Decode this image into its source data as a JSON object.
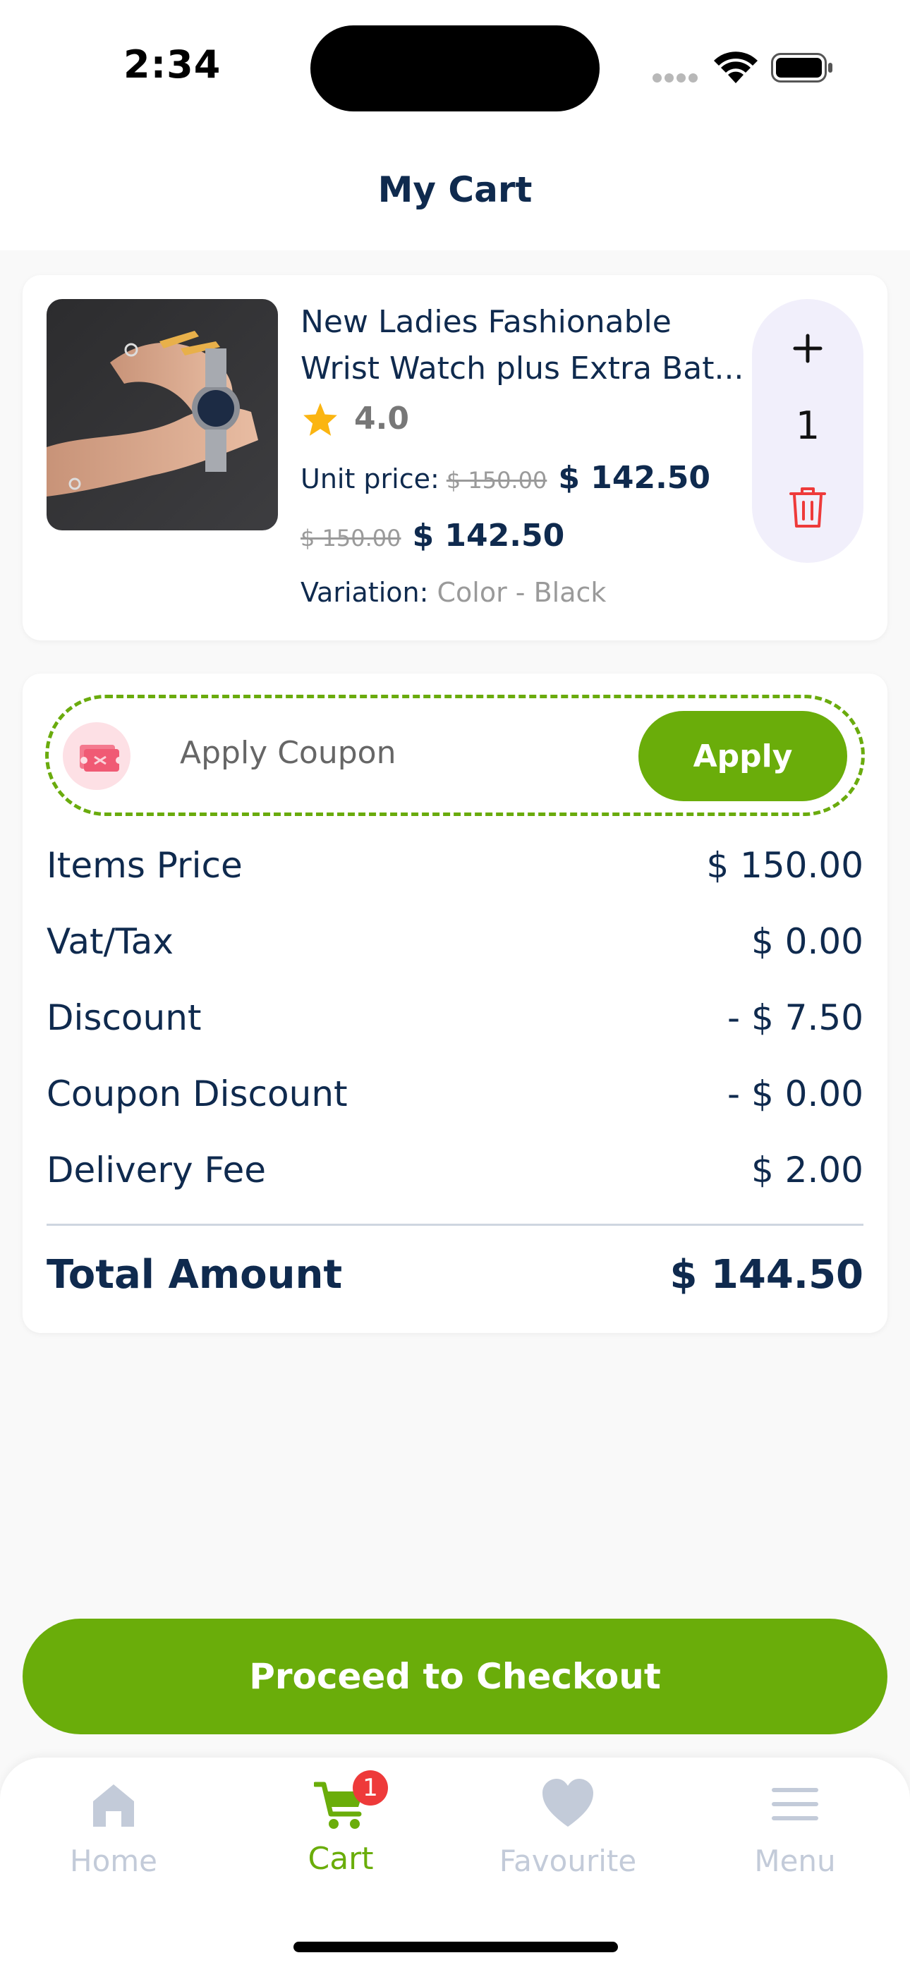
{
  "status_bar": {
    "time": "2:34"
  },
  "header": {
    "title": "My Cart"
  },
  "cart": {
    "items": [
      {
        "name_line1": "New Ladies Fashionable",
        "name_line2": "Wrist Watch plus Extra Bat...",
        "rating": "4.0",
        "unit_price_label": "Unit price:",
        "original_price": "$ 150.00",
        "unit_price": "$ 142.50",
        "total_original": "$ 150.00",
        "total_price": "$ 142.50",
        "variation_label": "Variation:",
        "variation_value": "Color - Black",
        "quantity": "1"
      }
    ]
  },
  "coupon": {
    "placeholder": "Apply Coupon",
    "apply_label": "Apply"
  },
  "summary": {
    "rows": [
      {
        "label": "Items Price",
        "value": "$ 150.00"
      },
      {
        "label": "Vat/Tax",
        "value": "$ 0.00"
      },
      {
        "label": "Discount",
        "value": "- $ 7.50"
      },
      {
        "label": "Coupon Discount",
        "value": "- $ 0.00"
      },
      {
        "label": "Delivery Fee",
        "value": "$ 2.00"
      }
    ],
    "total_label": "Total Amount",
    "total_value": "$ 144.50"
  },
  "checkout": {
    "label": "Proceed to Checkout"
  },
  "nav": {
    "items": [
      {
        "label": "Home",
        "icon": "home-icon"
      },
      {
        "label": "Cart",
        "icon": "cart-icon"
      },
      {
        "label": "Favourite",
        "icon": "heart-icon"
      },
      {
        "label": "Menu",
        "icon": "menu-icon"
      }
    ],
    "cart_badge": "1",
    "active_color": "#6aad0a",
    "inactive_color": "#c3cbd9"
  },
  "colors": {
    "brand_green": "#6aad0a",
    "text_navy": "#0f2a4e",
    "delete_red": "#ee3a3a"
  }
}
